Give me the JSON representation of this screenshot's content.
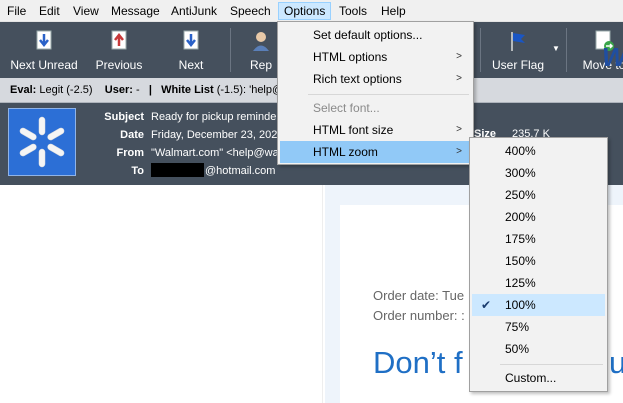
{
  "menubar": [
    "File",
    "Edit",
    "View",
    "Message",
    "AntiJunk",
    "Speech",
    "Options",
    "Tools",
    "Help"
  ],
  "toolbar": {
    "next_unread": "Next Unread",
    "previous": "Previous",
    "next": "Next",
    "reply": "Rep",
    "user_flag": "User Flag",
    "move_to": "Move to"
  },
  "evalbar": {
    "eval_label": "Eval:",
    "eval_value": "Legit (-2.5)",
    "user_label": "User:",
    "user_value": "-",
    "sep": "|",
    "whitelist_label": "White List",
    "whitelist_value": "(-1.5): 'help@"
  },
  "header": {
    "subject_label": "Subject",
    "subject_value": "Ready for pickup reminder",
    "date_label": "Date",
    "date_value": "Friday, December 23, 202",
    "from_label": "From",
    "from_value": "\"Walmart.com\" <help@wa",
    "to_label": "To",
    "to_value": "@hotmail.com",
    "size_label": "Size",
    "size_value": "235.7 K"
  },
  "email": {
    "brand": "Wa",
    "order_date": "Order date: Tue",
    "order_number": "Order number: :",
    "headline": "Don’t f",
    "headline_tail": "u"
  },
  "options_menu": {
    "set_default": "Set default options...",
    "html_options": "HTML options",
    "rich_text_options": "Rich text options",
    "select_font": "Select font...",
    "html_font_size": "HTML font size",
    "html_zoom": "HTML zoom"
  },
  "zoom_menu": {
    "items": [
      "400%",
      "300%",
      "250%",
      "200%",
      "175%",
      "150%",
      "125%",
      "100%",
      "75%",
      "50%"
    ],
    "selected": "100%",
    "custom": "Custom..."
  },
  "colors": {
    "toolbar_bg": "#45505d",
    "highlight": "#91c9f7",
    "headline_blue": "#1f6fc5"
  }
}
